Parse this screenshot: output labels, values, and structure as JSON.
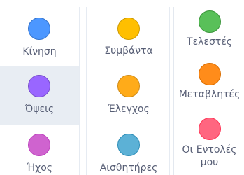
{
  "categories": {
    "column1": [
      {
        "label": "Κίνηση",
        "color": "#4c97ff",
        "border": "#3373cc",
        "selected": false
      },
      {
        "label": "Όψεις",
        "color": "#9966ff",
        "border": "#774dcb",
        "selected": true
      },
      {
        "label": "Ήχος",
        "color": "#cf63cf",
        "border": "#bd42bd",
        "selected": false
      }
    ],
    "column2": [
      {
        "label": "Συμβάντα",
        "color": "#ffbf00",
        "border": "#cc9900",
        "selected": false
      },
      {
        "label": "Έλεγχος",
        "color": "#ffab19",
        "border": "#cf8b17",
        "selected": false
      },
      {
        "label": "Αισθητήρες",
        "color": "#5cb1d6",
        "border": "#2e8eb8",
        "selected": false
      }
    ],
    "column3": [
      {
        "label": "Τελεστές",
        "color": "#59c059",
        "border": "#389438",
        "selected": false
      },
      {
        "label": "Μεταβλητές",
        "color": "#ff8c1a",
        "border": "#db6e00",
        "selected": false
      },
      {
        "label": "Οι Εντολές μου",
        "color": "#ff6680",
        "border": "#ff3355",
        "selected": false
      }
    ]
  }
}
